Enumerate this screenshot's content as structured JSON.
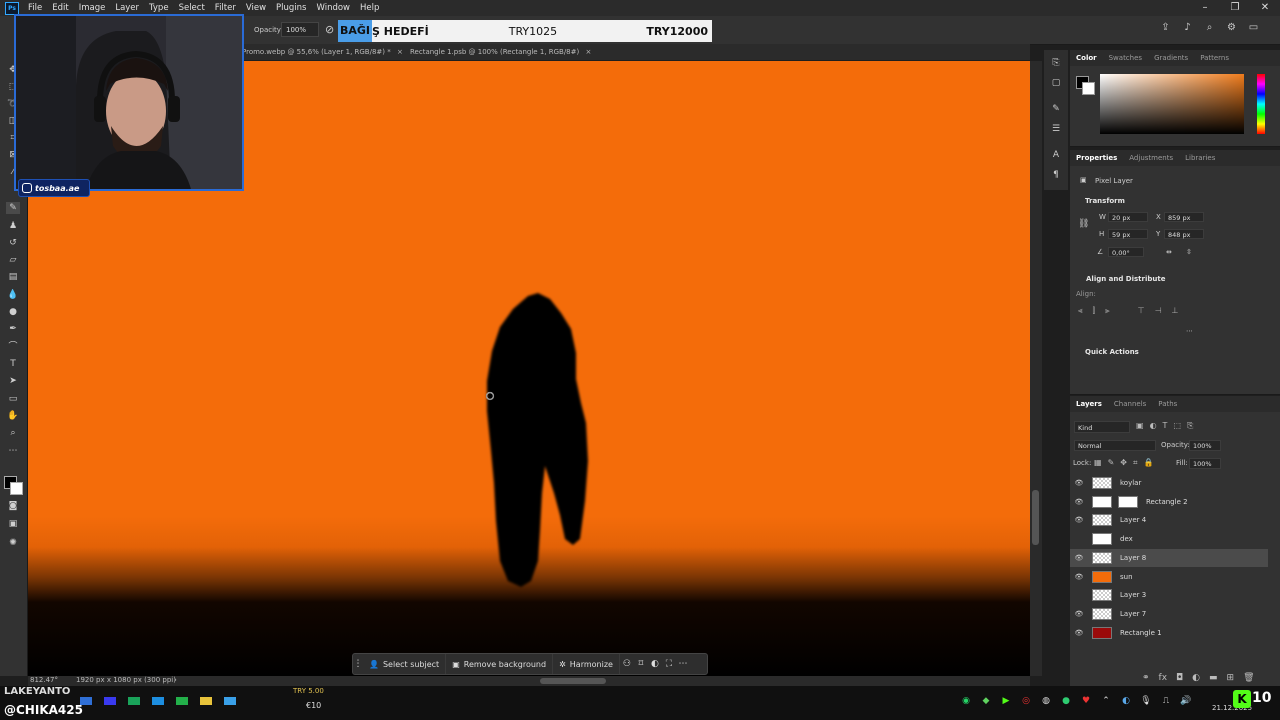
{
  "menu": {
    "app_icon": "Ps",
    "items": [
      "File",
      "Edit",
      "Image",
      "Layer",
      "Type",
      "Select",
      "Filter",
      "View",
      "Plugins",
      "Window",
      "Help"
    ]
  },
  "options_bar": {
    "opacity_label": "Opacity:",
    "opacity_value": "100%"
  },
  "donation_overlay": {
    "highlight": "BAĞI",
    "title_rest": "Ş HEDEFİ",
    "current": "TRY1025",
    "goal": "TRY12000"
  },
  "tabs": [
    {
      "label": "Promo.webp @ 55,6% (Layer 1, RGB/8#) *",
      "close": "×"
    },
    {
      "label": "Rectangle 1.psb @ 100% (Rectangle 1, RGB/8#)",
      "close": "×"
    }
  ],
  "webcam": {
    "social_handle": "tosbaa.ae"
  },
  "context_bar": {
    "select_subject": "Select subject",
    "remove_background": "Remove background",
    "harmonize": "Harmonize"
  },
  "status": {
    "zoom": "812.47°",
    "doc_info": "1920 px x 1080 px (300 ppi)"
  },
  "color_panel": {
    "tabs": [
      "Color",
      "Swatches",
      "Gradients",
      "Patterns"
    ],
    "active": "Color"
  },
  "properties_panel": {
    "tabs": [
      "Properties",
      "Adjustments",
      "Libraries"
    ],
    "layer_type": "Pixel Layer",
    "transform_header": "Transform",
    "w_label": "W",
    "w_value": "20 px",
    "h_label": "H",
    "h_value": "59 px",
    "x_label": "X",
    "x_value": "859 px",
    "y_label": "Y",
    "y_value": "848 px",
    "angle_value": "0,00°",
    "align_header": "Align and Distribute",
    "align_label": "Align:",
    "quick_actions": "Quick Actions"
  },
  "layers_panel": {
    "tabs": [
      "Layers",
      "Channels",
      "Paths"
    ],
    "kind_label": "Kind",
    "blend_mode": "Normal",
    "opacity_label": "Opacity:",
    "opacity_value": "100%",
    "lock_label": "Lock:",
    "fill_label": "Fill:",
    "fill_value": "100%",
    "layers": [
      {
        "name": "koylar",
        "visible": true,
        "selected": false,
        "thumb": "transparent"
      },
      {
        "name": "Rectangle 2",
        "visible": true,
        "selected": false,
        "thumb": "mask"
      },
      {
        "name": "Layer 4",
        "visible": true,
        "selected": false,
        "thumb": "transparent"
      },
      {
        "name": "dex",
        "visible": false,
        "selected": false,
        "thumb": "figure"
      },
      {
        "name": "Layer 8",
        "visible": true,
        "selected": true,
        "thumb": "transparent"
      },
      {
        "name": "sun",
        "visible": true,
        "selected": false,
        "thumb": "orange"
      },
      {
        "name": "Layer 3",
        "visible": false,
        "selected": false,
        "thumb": "transparent"
      },
      {
        "name": "Layer 7",
        "visible": true,
        "selected": false,
        "thumb": "transparent"
      },
      {
        "name": "Rectangle 1",
        "visible": true,
        "selected": false,
        "thumb": "red"
      }
    ]
  },
  "overlay_text": {
    "streamer_name": "LAKEYANTO",
    "handle": "@CHIKA425",
    "ticker": "TRY 5.00",
    "ticker_value": "€10",
    "date": "21.12.2025",
    "clock_badge": "10"
  },
  "colors": {
    "canvas_orange": "#f46c0a",
    "accent_blue": "#31a8ff",
    "donation_highlight": "#4a9de8",
    "badge_green": "#53fc18"
  }
}
